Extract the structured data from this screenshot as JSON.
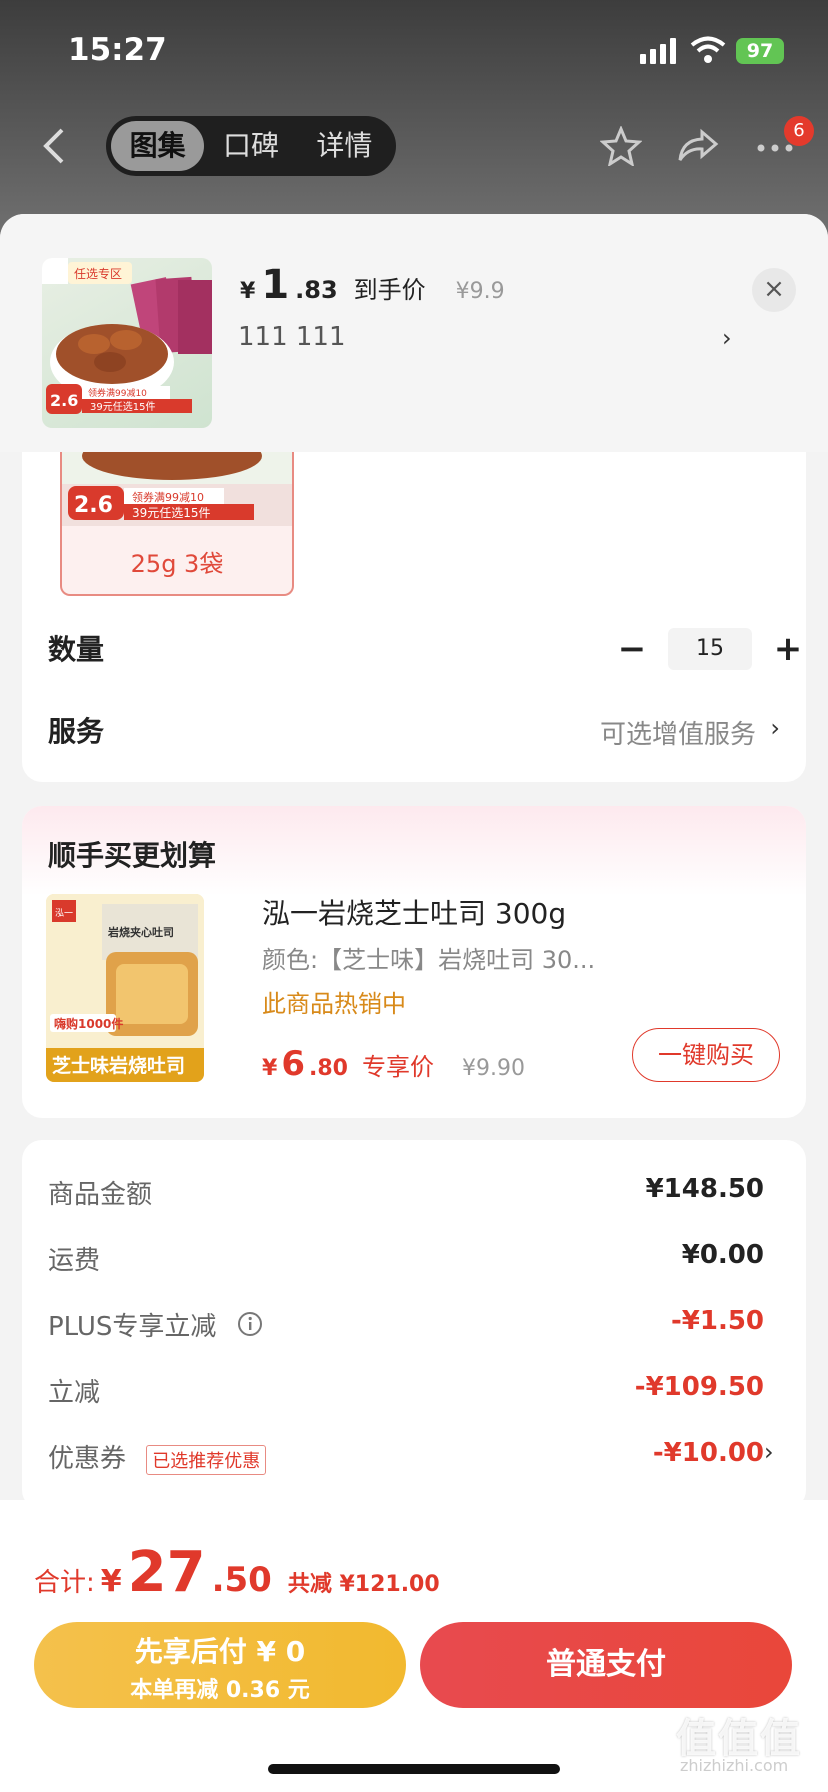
{
  "status": {
    "time": "15:27",
    "battery": "97"
  },
  "nav": {
    "tabs": [
      "图集",
      "口碑",
      "详情"
    ],
    "badge": "6"
  },
  "header": {
    "currency": "¥",
    "price_int": "1",
    "price_dec": ".83",
    "price_label": "到手价",
    "orig_price": "¥9.9",
    "spec": "111  111",
    "close": "×",
    "img_tag": "任选专区",
    "img_price": "2.6",
    "img_promo1": "领券满99减10",
    "img_promo2": "39元任选15件"
  },
  "options": {
    "variant_label": "25g 3袋",
    "variant_price": "2.6",
    "variant_promo1": "领券满99减10",
    "variant_promo2": "39元任选15件",
    "quantity_label": "数量",
    "quantity": "15",
    "minus": "−",
    "plus": "+",
    "service_label": "服务",
    "service_value": "可选增值服务"
  },
  "addon": {
    "title": "顺手买更划算",
    "name": "泓一岩烧芝士吐司 300g",
    "color": "颜色:【芝士味】岩烧吐司 30...",
    "hot": "此商品热销中",
    "currency": "¥",
    "price_int": "6",
    "price_dec": ".80",
    "price_label": "专享价",
    "orig_price": "¥9.90",
    "buy_label": "一键购买",
    "img_brand": "泓一",
    "img_box": "岩烧夹心吐司",
    "img_sold": "嗨购1000件",
    "img_caption": "芝士味岩烧吐司"
  },
  "summary": {
    "rows": [
      {
        "label": "商品金额",
        "value": "¥148.50"
      },
      {
        "label": "运费",
        "value": "¥0.00"
      },
      {
        "label": "PLUS专享立减",
        "value": "-¥1.50"
      },
      {
        "label": "立减",
        "value": "-¥109.50"
      },
      {
        "label": "优惠券",
        "value": "-¥10.00"
      }
    ],
    "coupon_tag": "已选推荐优惠"
  },
  "footer": {
    "total_label": "合计:",
    "currency": "¥",
    "total_int": "27",
    "total_dec": ".50",
    "saved": "共减 ¥121.00",
    "pay_later_line1": "先享后付 ¥ 0",
    "pay_later_line2": "本单再减 0.36 元",
    "pay_normal": "普通支付"
  },
  "watermark": {
    "main": "值值值",
    "site": "zhizhizhi.com"
  },
  "colors": {
    "accent": "#e0392b",
    "gold": "#f2b92f",
    "hot": "#d88a1a"
  }
}
